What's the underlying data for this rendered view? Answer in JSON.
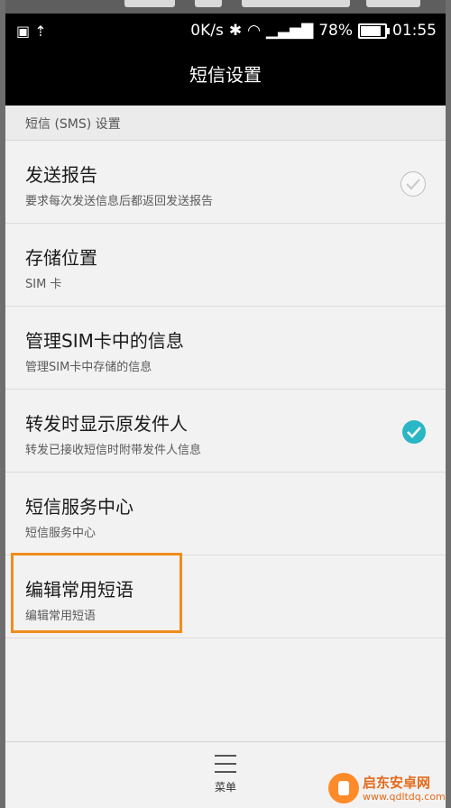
{
  "status_bar": {
    "net_speed": "0K/s",
    "battery_percent": "78%",
    "battery_level": 0.78,
    "time": "01:55"
  },
  "action_bar": {
    "title": "短信设置"
  },
  "section": {
    "header": "短信 (SMS) 设置"
  },
  "settings": [
    {
      "title": "发送报告",
      "subtitle": "要求每次发送信息后都返回发送报告",
      "checkbox": "unchecked"
    },
    {
      "title": "存储位置",
      "subtitle": "SIM 卡"
    },
    {
      "title": "管理SIM卡中的信息",
      "subtitle": "管理SIM卡中存储的信息"
    },
    {
      "title": "转发时显示原发件人",
      "subtitle": "转发已接收短信时附带发件人信息",
      "checkbox": "checked"
    },
    {
      "title": "短信服务中心",
      "subtitle": "短信服务中心"
    },
    {
      "title": "编辑常用短语",
      "subtitle": "编辑常用短语"
    }
  ],
  "bottom_bar": {
    "menu_label": "菜单"
  },
  "watermark": {
    "name": "启东安卓网",
    "url": "www.qdltdq.com"
  },
  "colors": {
    "accent": "#2ab6c4",
    "highlight": "#f08c1c"
  }
}
